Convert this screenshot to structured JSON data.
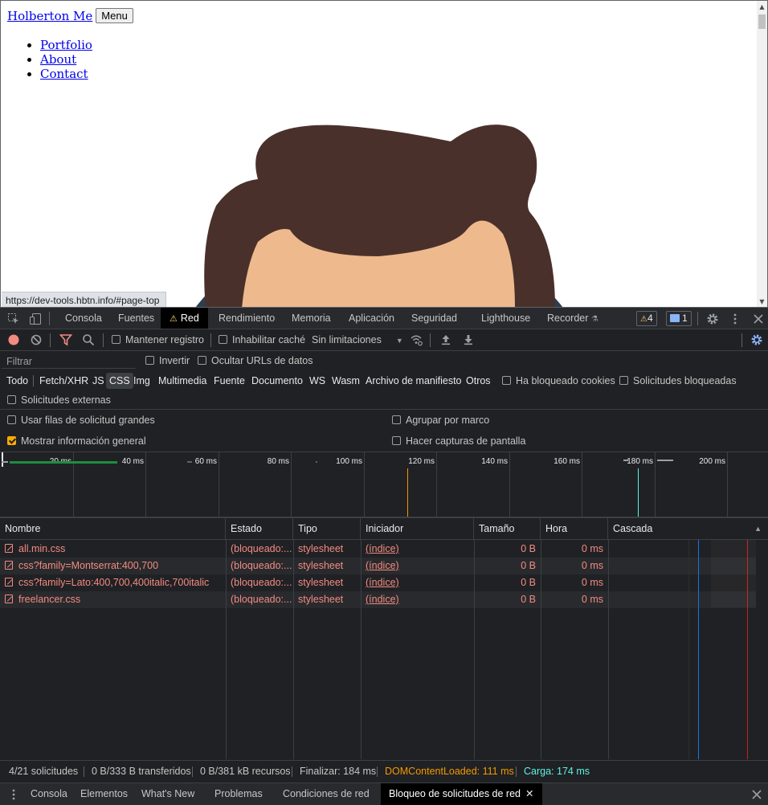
{
  "page": {
    "brand": "Holberton Me",
    "menu_button": "Menu",
    "nav": [
      "Portfolio",
      "About",
      "Contact"
    ],
    "status_url": "https://dev-tools.hbtn.info/#page-top"
  },
  "devtools": {
    "tabs": [
      "Consola",
      "Fuentes",
      "Red",
      "Rendimiento",
      "Memoria",
      "Aplicación",
      "Seguridad",
      "Lighthouse",
      "Recorder"
    ],
    "active_tab": "Red",
    "warning_count": "4",
    "message_count": "1",
    "toolbar": {
      "preserve_log": "Mantener registro",
      "disable_cache": "Inhabilitar caché",
      "throttling": "Sin limitaciones"
    },
    "filter": {
      "placeholder": "Filtrar",
      "invert": "Invertir",
      "hide_data_urls": "Ocultar URLs de datos"
    },
    "types": [
      "Todo",
      "Fetch/XHR",
      "JS",
      "CSS",
      "Img",
      "Multimedia",
      "Fuente",
      "Documento",
      "WS",
      "Wasm",
      "Archivo de manifiesto",
      "Otros"
    ],
    "active_type": "CSS",
    "blocked_cookies": "Ha bloqueado cookies",
    "blocked_requests": "Solicitudes bloqueadas",
    "external_requests": "Solicitudes externas",
    "options": {
      "large_rows": "Usar filas de solicitud grandes",
      "group_by_frame": "Agrupar por marco",
      "show_overview": "Mostrar información general",
      "screenshots": "Hacer capturas de pantalla"
    },
    "overview_ticks": [
      "20 ms",
      "40 ms",
      "60 ms",
      "80 ms",
      "100 ms",
      "120 ms",
      "140 ms",
      "160 ms",
      "180 ms",
      "200 ms"
    ],
    "columns": [
      "Nombre",
      "Estado",
      "Tipo",
      "Iniciador",
      "Tamaño",
      "Hora",
      "Cascada"
    ],
    "rows": [
      {
        "name": "all.min.css",
        "status": "(bloqueado:...",
        "type": "stylesheet",
        "initiator": "(índice)",
        "size": "0 B",
        "time": "0 ms"
      },
      {
        "name": "css?family=Montserrat:400,700",
        "status": "(bloqueado:...",
        "type": "stylesheet",
        "initiator": "(índice)",
        "size": "0 B",
        "time": "0 ms"
      },
      {
        "name": "css?family=Lato:400,700,400italic,700italic",
        "status": "(bloqueado:...",
        "type": "stylesheet",
        "initiator": "(índice)",
        "size": "0 B",
        "time": "0 ms"
      },
      {
        "name": "freelancer.css",
        "status": "(bloqueado:...",
        "type": "stylesheet",
        "initiator": "(índice)",
        "size": "0 B",
        "time": "0 ms"
      }
    ],
    "summary": {
      "requests": "4/21 solicitudes",
      "transferred": "0 B/333 B transferidos",
      "resources": "0 B/381 kB recursos",
      "finish": "Finalizar: 184 ms",
      "dcl": "DOMContentLoaded: 111 ms",
      "load": "Carga: 174 ms"
    },
    "drawer_tabs": [
      "Consola",
      "Elementos",
      "What's New",
      "Problemas",
      "Condiciones de red",
      "Bloqueo de solicitudes de red"
    ],
    "active_drawer_tab": "Bloqueo de solicitudes de red",
    "colors": {
      "dcl": "#f29900",
      "load": "#5ef2e4",
      "error": "#f28b82"
    }
  }
}
